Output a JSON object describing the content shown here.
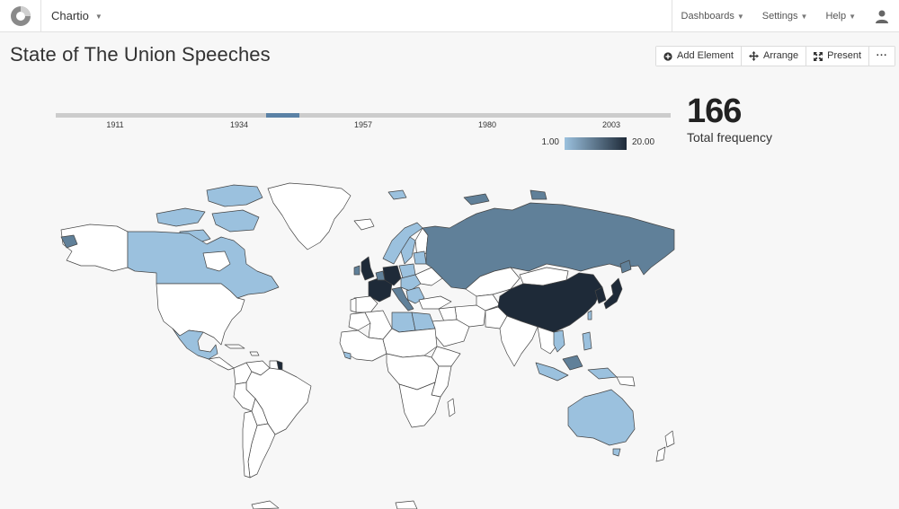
{
  "app": {
    "brand": "Chartio"
  },
  "nav": {
    "dashboards": "Dashboards",
    "settings": "Settings",
    "help": "Help"
  },
  "page": {
    "title": "State of The Union Speeches"
  },
  "toolbar": {
    "add_element": "Add Element",
    "arrange": "Arrange",
    "present": "Present",
    "more": "···"
  },
  "timeline": {
    "ticks": [
      "1911",
      "1934",
      "1957",
      "1980",
      "2003"
    ]
  },
  "legend": {
    "min_label": "1.00",
    "max_label": "20.00",
    "min_color": "#9bc1de",
    "max_color": "#1e2a38"
  },
  "stat": {
    "value": "166",
    "label": "Total frequency"
  },
  "colors": {
    "none": "#ffffff",
    "light": "#9bc1de",
    "mid": "#608099",
    "dark": "#1e2a38",
    "accent": "#5b82a6"
  }
}
